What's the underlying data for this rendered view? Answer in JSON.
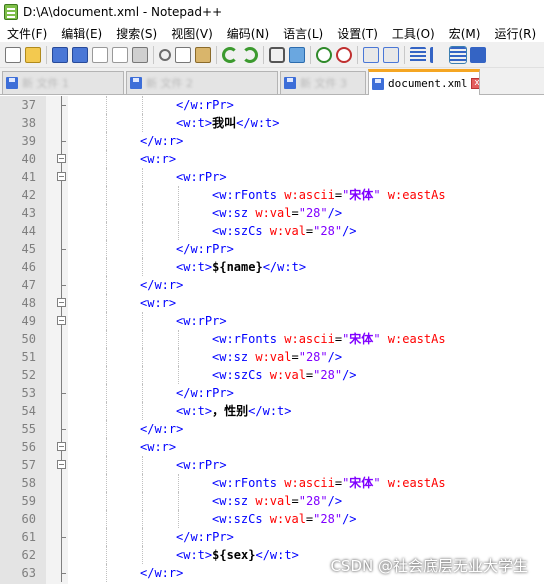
{
  "window": {
    "title": "D:\\A\\document.xml - Notepad++"
  },
  "menu": [
    "文件(F)",
    "编辑(E)",
    "搜索(S)",
    "视图(V)",
    "编码(N)",
    "语言(L)",
    "设置(T)",
    "工具(O)",
    "宏(M)",
    "运行(R)",
    "插"
  ],
  "toolbar_icons": [
    "new-file-icon",
    "open-file-icon",
    "save-icon",
    "save-all-icon",
    "close-icon",
    "close-all-icon",
    "print-icon",
    "cut-icon",
    "copy-icon",
    "paste-icon",
    "undo-icon",
    "redo-icon",
    "find-icon",
    "replace-icon",
    "zoom-in-icon",
    "zoom-out-icon",
    "sync-v-icon",
    "sync-h-icon",
    "word-wrap-icon",
    "show-all-chars-icon",
    "indent-guide-icon",
    "lang-icon"
  ],
  "tabs": [
    {
      "label": "新 文件 1",
      "active": false
    },
    {
      "label": "新 文件 2",
      "active": false
    },
    {
      "label": "新 文件 3",
      "active": false
    },
    {
      "label": "document.xml",
      "active": true
    }
  ],
  "tab_close_glyph": "x",
  "watermark": "CSDN @社会底层无业大学生",
  "lines": [
    {
      "n": "37",
      "indent": 3,
      "parts": [
        [
          "t",
          "</w:rPr>"
        ]
      ]
    },
    {
      "n": "38",
      "indent": 3,
      "parts": [
        [
          "t",
          "<w:t>"
        ],
        [
          "c",
          "我叫"
        ],
        [
          "t",
          "</w:t>"
        ]
      ]
    },
    {
      "n": "39",
      "indent": 2,
      "parts": [
        [
          "t",
          "</w:r>"
        ]
      ]
    },
    {
      "n": "40",
      "indent": 2,
      "parts": [
        [
          "t",
          "<w:r>"
        ]
      ]
    },
    {
      "n": "41",
      "indent": 3,
      "parts": [
        [
          "t",
          "<w:rPr>"
        ]
      ]
    },
    {
      "n": "42",
      "indent": 4,
      "parts": [
        [
          "t",
          "<w:rFonts "
        ],
        [
          "a",
          "w:ascii"
        ],
        [
          "e",
          "="
        ],
        [
          "v",
          "\""
        ],
        [
          "vb",
          "宋体"
        ],
        [
          "v",
          "\" "
        ],
        [
          "a",
          "w:eastAs"
        ]
      ]
    },
    {
      "n": "43",
      "indent": 4,
      "parts": [
        [
          "t",
          "<w:sz "
        ],
        [
          "a",
          "w:val"
        ],
        [
          "e",
          "="
        ],
        [
          "v",
          "\"28\""
        ],
        [
          "t",
          "/>"
        ]
      ]
    },
    {
      "n": "44",
      "indent": 4,
      "parts": [
        [
          "t",
          "<w:szCs "
        ],
        [
          "a",
          "w:val"
        ],
        [
          "e",
          "="
        ],
        [
          "v",
          "\"28\""
        ],
        [
          "t",
          "/>"
        ]
      ]
    },
    {
      "n": "45",
      "indent": 3,
      "parts": [
        [
          "t",
          "</w:rPr>"
        ]
      ]
    },
    {
      "n": "46",
      "indent": 3,
      "parts": [
        [
          "t",
          "<w:t>"
        ],
        [
          "x",
          "${name}"
        ],
        [
          "t",
          "</w:t>"
        ]
      ]
    },
    {
      "n": "47",
      "indent": 2,
      "parts": [
        [
          "t",
          "</w:r>"
        ]
      ]
    },
    {
      "n": "48",
      "indent": 2,
      "parts": [
        [
          "t",
          "<w:r>"
        ]
      ]
    },
    {
      "n": "49",
      "indent": 3,
      "parts": [
        [
          "t",
          "<w:rPr>"
        ]
      ]
    },
    {
      "n": "50",
      "indent": 4,
      "parts": [
        [
          "t",
          "<w:rFonts "
        ],
        [
          "a",
          "w:ascii"
        ],
        [
          "e",
          "="
        ],
        [
          "v",
          "\""
        ],
        [
          "vb",
          "宋体"
        ],
        [
          "v",
          "\" "
        ],
        [
          "a",
          "w:eastAs"
        ]
      ]
    },
    {
      "n": "51",
      "indent": 4,
      "parts": [
        [
          "t",
          "<w:sz "
        ],
        [
          "a",
          "w:val"
        ],
        [
          "e",
          "="
        ],
        [
          "v",
          "\"28\""
        ],
        [
          "t",
          "/>"
        ]
      ]
    },
    {
      "n": "52",
      "indent": 4,
      "parts": [
        [
          "t",
          "<w:szCs "
        ],
        [
          "a",
          "w:val"
        ],
        [
          "e",
          "="
        ],
        [
          "v",
          "\"28\""
        ],
        [
          "t",
          "/>"
        ]
      ]
    },
    {
      "n": "53",
      "indent": 3,
      "parts": [
        [
          "t",
          "</w:rPr>"
        ]
      ]
    },
    {
      "n": "54",
      "indent": 3,
      "parts": [
        [
          "t",
          "<w:t>"
        ],
        [
          "c",
          "，性别"
        ],
        [
          "t",
          "</w:t>"
        ]
      ]
    },
    {
      "n": "55",
      "indent": 2,
      "parts": [
        [
          "t",
          "</w:r>"
        ]
      ]
    },
    {
      "n": "56",
      "indent": 2,
      "parts": [
        [
          "t",
          "<w:r>"
        ]
      ]
    },
    {
      "n": "57",
      "indent": 3,
      "parts": [
        [
          "t",
          "<w:rPr>"
        ]
      ]
    },
    {
      "n": "58",
      "indent": 4,
      "parts": [
        [
          "t",
          "<w:rFonts "
        ],
        [
          "a",
          "w:ascii"
        ],
        [
          "e",
          "="
        ],
        [
          "v",
          "\""
        ],
        [
          "vb",
          "宋体"
        ],
        [
          "v",
          "\" "
        ],
        [
          "a",
          "w:eastAs"
        ]
      ]
    },
    {
      "n": "59",
      "indent": 4,
      "parts": [
        [
          "t",
          "<w:sz "
        ],
        [
          "a",
          "w:val"
        ],
        [
          "e",
          "="
        ],
        [
          "v",
          "\"28\""
        ],
        [
          "t",
          "/>"
        ]
      ]
    },
    {
      "n": "60",
      "indent": 4,
      "parts": [
        [
          "t",
          "<w:szCs "
        ],
        [
          "a",
          "w:val"
        ],
        [
          "e",
          "="
        ],
        [
          "v",
          "\"28\""
        ],
        [
          "t",
          "/>"
        ]
      ]
    },
    {
      "n": "61",
      "indent": 3,
      "parts": [
        [
          "t",
          "</w:rPr>"
        ]
      ]
    },
    {
      "n": "62",
      "indent": 3,
      "parts": [
        [
          "t",
          "<w:t>"
        ],
        [
          "x",
          "${sex}"
        ],
        [
          "t",
          "</w:t>"
        ]
      ]
    },
    {
      "n": "63",
      "indent": 2,
      "parts": [
        [
          "t",
          "</w:r>"
        ]
      ]
    }
  ]
}
